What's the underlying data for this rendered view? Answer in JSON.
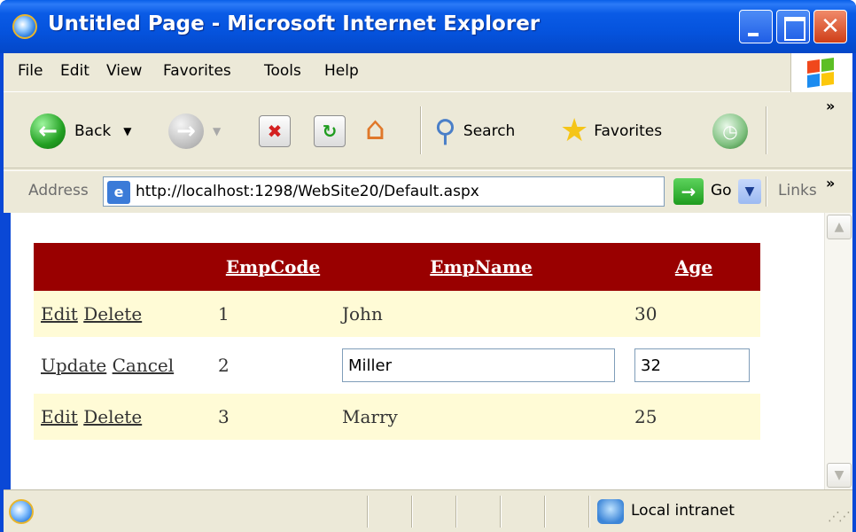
{
  "window": {
    "title": "Untitled Page - Microsoft Internet Explorer"
  },
  "menu": {
    "items": [
      {
        "label": "File"
      },
      {
        "label": "Edit"
      },
      {
        "label": "View"
      },
      {
        "label": "Favorites"
      },
      {
        "label": "Tools"
      },
      {
        "label": "Help"
      }
    ]
  },
  "toolbar": {
    "back_label": "Back",
    "search_label": "Search",
    "favorites_label": "Favorites"
  },
  "address": {
    "label": "Address",
    "url": "http://localhost:1298/WebSite20/Default.aspx",
    "go_label": "Go",
    "links_label": "Links"
  },
  "grid": {
    "header_bg": "#990000",
    "headers": {
      "code": "EmpCode",
      "name": "EmpName",
      "age": "Age"
    },
    "rows": [
      {
        "action1": "Edit",
        "action2": "Delete",
        "code": "1",
        "name": "John",
        "age": "30"
      },
      {
        "action1": "Update",
        "action2": "Cancel",
        "code": "2",
        "name": "Miller",
        "age": "32"
      },
      {
        "action1": "Edit",
        "action2": "Delete",
        "code": "3",
        "name": "Marry",
        "age": "25"
      }
    ]
  },
  "status": {
    "zone": "Local intranet"
  }
}
